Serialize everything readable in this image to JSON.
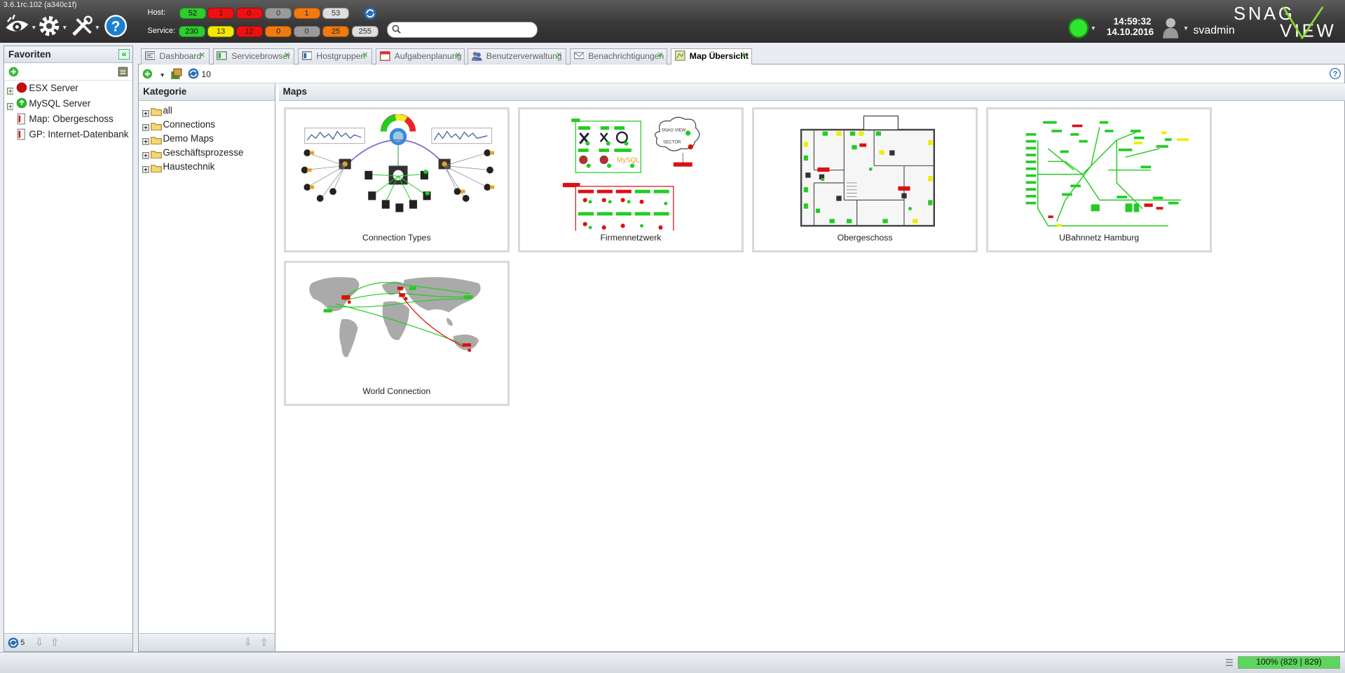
{
  "app": {
    "version": "3.6.1rc.102 (a340c1f)",
    "product": "SNAG VIEW",
    "time": "14:59:32",
    "date": "14.10.2016",
    "user": "svadmin"
  },
  "host_label": "Host:",
  "service_label": "Service:",
  "host_counts": [
    {
      "value": "52",
      "color": "green"
    },
    {
      "value": "1",
      "color": "red"
    },
    {
      "value": "0",
      "color": "red"
    },
    {
      "value": "0",
      "color": "grey"
    },
    {
      "value": "1",
      "color": "orange"
    },
    {
      "value": "53",
      "color": "lgrey"
    }
  ],
  "service_counts": [
    {
      "value": "230",
      "color": "green"
    },
    {
      "value": "13",
      "color": "yellow"
    },
    {
      "value": "12",
      "color": "red"
    },
    {
      "value": "0",
      "color": "orange"
    },
    {
      "value": "0",
      "color": "grey"
    },
    {
      "value": "25",
      "color": "orange"
    },
    {
      "value": "255",
      "color": "lgrey"
    }
  ],
  "search": {
    "placeholder": ""
  },
  "favorites": {
    "title": "Favoriten",
    "items": [
      {
        "label": "ESX Server",
        "icon": "red-status-icon"
      },
      {
        "label": "MySQL Server",
        "icon": "green-status-icon"
      },
      {
        "label": "Map: Obergeschoss",
        "icon": "map-icon"
      },
      {
        "label": "GP: Internet-Datenbank",
        "icon": "map-icon"
      }
    ],
    "refresh_count": "5"
  },
  "tabs": [
    {
      "label": "Dashboard"
    },
    {
      "label": "Servicebrowser"
    },
    {
      "label": "Hostgruppen"
    },
    {
      "label": "Aufgabenplanung"
    },
    {
      "label": "Benutzerverwaltung"
    },
    {
      "label": "Benachrichtigungen"
    },
    {
      "label": "Map Übersicht",
      "active": true
    }
  ],
  "toolbar": {
    "refresh_count": "10"
  },
  "kategorie": {
    "title": "Kategorie",
    "items": [
      "all",
      "Connections",
      "Demo Maps",
      "Geschäftsprozesse",
      "Haustechnik"
    ]
  },
  "maps": {
    "title": "Maps",
    "items": [
      {
        "label": "Connection Types"
      },
      {
        "label": "Firmennetzwerk"
      },
      {
        "label": "Obergeschoss"
      },
      {
        "label": "UBahnnetz Hamburg"
      },
      {
        "label": "World Connection"
      }
    ]
  },
  "statusbar": {
    "progress": "100% (829 | 829)",
    "progress_fraction": 1.0
  },
  "colors": {
    "green": "#2ecc2e",
    "red": "#ee1010",
    "yellow": "#f5e800",
    "orange": "#f07a10",
    "header": "#3a3a3a"
  }
}
